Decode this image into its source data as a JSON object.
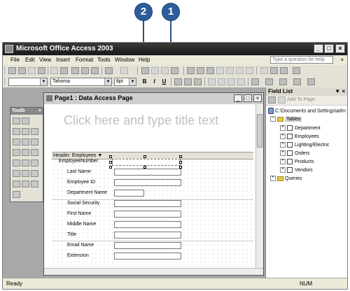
{
  "callouts": {
    "c1": "1",
    "c2": "2"
  },
  "window": {
    "title": "Microsoft Office Access 2003"
  },
  "menu": {
    "items": [
      "File",
      "Edit",
      "View",
      "Insert",
      "Format",
      "Tools",
      "Window",
      "Help"
    ],
    "help_placeholder": "Type a question for help"
  },
  "formatting": {
    "font": "Tahoma",
    "size": "8pt",
    "bold": "B",
    "italic": "I",
    "underline": "U"
  },
  "toolbox": {
    "title": "Toolb",
    "close": "×"
  },
  "document": {
    "title": "Page1 : Data Access Page",
    "title_placeholder": "Click here and type title text",
    "header_label": "Header: Employees ▼",
    "fields": [
      "EmployeeNumber",
      "Last Name",
      "Employee ID",
      "Department Name",
      "Social Security",
      "First Name",
      "Middle Name",
      "Title",
      "Email Name",
      "Extension"
    ]
  },
  "field_list": {
    "title": "Field List",
    "add_to_page": "Add To Page",
    "path": "C:\\Documents and Settings\\adm",
    "tables_label": "Tables",
    "tables": [
      "Department",
      "Employees",
      "Lighting/Electric",
      "Orders",
      "Products",
      "Vendors"
    ],
    "queries_label": "Queries"
  },
  "status": {
    "left": "Ready",
    "num": "NUM"
  },
  "colors": {
    "callout": "#2f5d9b",
    "titlebar": "#1f1f1f"
  }
}
